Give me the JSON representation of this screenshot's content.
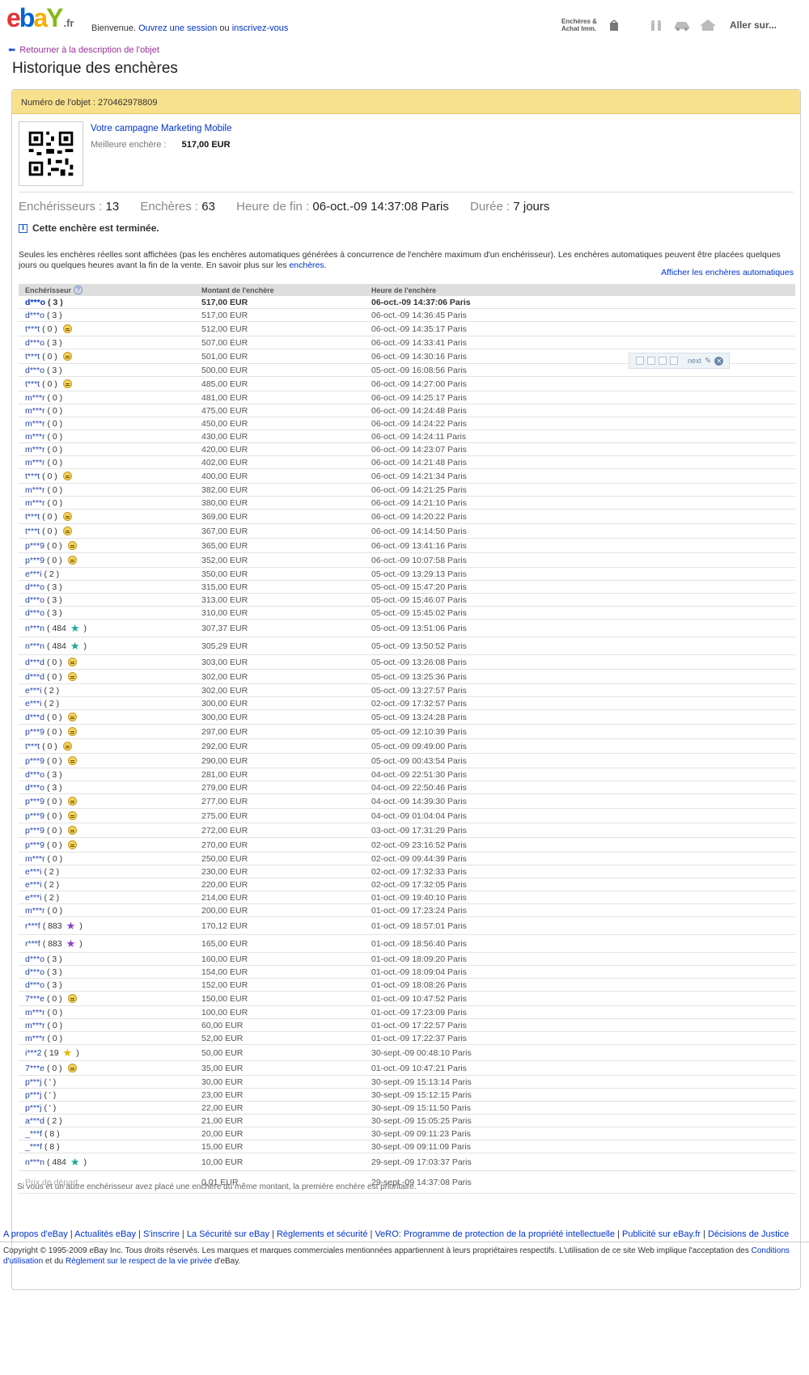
{
  "header": {
    "logo": "ebay",
    "logo_suffix": ".fr",
    "welcome": "Bienvenue.",
    "signin_link": "Ouvrez une session",
    "or": "ou",
    "register_link": "inscrivez-vous",
    "right_label_line1": "Enchères &",
    "right_label_line2": "Achat Imm.",
    "goto": "Aller sur..."
  },
  "back_link": "Retourner à la description de l'objet",
  "page_title": "Historique des enchères",
  "item": {
    "number_label": "Numéro de l'objet :",
    "number": "270462978809",
    "campaign_link": "Votre campagne Marketing Mobile",
    "best_bid_label": "Meilleure enchère :",
    "best_bid_value": "517,00 EUR"
  },
  "stats": {
    "bidders_label": "Enchérisseurs :",
    "bidders": "13",
    "bids_label": "Enchères :",
    "bids": "63",
    "end_label": "Heure de fin :",
    "end": "06-oct.-09 14:37:08 Paris",
    "duration_label": "Durée :",
    "duration": "7 jours"
  },
  "ended_msg": "Cette enchère est terminée.",
  "note": "Seules les enchères réelles sont affichées (pas les enchères automatiques générées à concurrence de l'enchère maximum d'un enchérisseur). Les enchères automatiques peuvent être placées quelques jours ou quelques heures avant la fin de la vente. En savoir plus sur les",
  "note_link": "enchères",
  "auto_link": "Afficher les enchères automatiques",
  "table": {
    "headers": [
      "Enchérisseur",
      "Montant de l'enchère",
      "Heure de l'enchère"
    ],
    "rows": [
      {
        "bidder": "d***o",
        "fb": "( 3 )",
        "icon": "",
        "amount": "517,00 EUR",
        "time": "06-oct.-09 14:37:06 Paris"
      },
      {
        "bidder": "d***o",
        "fb": "( 3 )",
        "icon": "",
        "amount": "517,00 EUR",
        "time": "06-oct.-09 14:36:45 Paris"
      },
      {
        "bidder": "t***t",
        "fb": "( 0 )",
        "icon": "bee",
        "amount": "512,00 EUR",
        "time": "06-oct.-09 14:35:17 Paris"
      },
      {
        "bidder": "d***o",
        "fb": "( 3 )",
        "icon": "",
        "amount": "507,00 EUR",
        "time": "06-oct.-09 14:33:41 Paris"
      },
      {
        "bidder": "t***t",
        "fb": "( 0 )",
        "icon": "bee",
        "amount": "501,00 EUR",
        "time": "06-oct.-09 14:30:16 Paris"
      },
      {
        "bidder": "d***o",
        "fb": "( 3 )",
        "icon": "",
        "amount": "500,00 EUR",
        "time": "05-oct.-09 16:08:56 Paris"
      },
      {
        "bidder": "t***t",
        "fb": "( 0 )",
        "icon": "bee",
        "amount": "485,00 EUR",
        "time": "06-oct.-09 14:27:00 Paris"
      },
      {
        "bidder": "m***r",
        "fb": "( 0 )",
        "icon": "",
        "amount": "481,00 EUR",
        "time": "06-oct.-09 14:25:17 Paris"
      },
      {
        "bidder": "m***r",
        "fb": "( 0 )",
        "icon": "",
        "amount": "475,00 EUR",
        "time": "06-oct.-09 14:24:48 Paris"
      },
      {
        "bidder": "m***r",
        "fb": "( 0 )",
        "icon": "",
        "amount": "450,00 EUR",
        "time": "06-oct.-09 14:24:22 Paris"
      },
      {
        "bidder": "m***r",
        "fb": "( 0 )",
        "icon": "",
        "amount": "430,00 EUR",
        "time": "06-oct.-09 14:24:11 Paris"
      },
      {
        "bidder": "m***r",
        "fb": "( 0 )",
        "icon": "",
        "amount": "420,00 EUR",
        "time": "06-oct.-09 14:23:07 Paris"
      },
      {
        "bidder": "m***r",
        "fb": "( 0 )",
        "icon": "",
        "amount": "402,00 EUR",
        "time": "06-oct.-09 14:21:48 Paris"
      },
      {
        "bidder": "t***t",
        "fb": "( 0 )",
        "icon": "bee",
        "amount": "400,00 EUR",
        "time": "06-oct.-09 14:21:34 Paris"
      },
      {
        "bidder": "m***r",
        "fb": "( 0 )",
        "icon": "",
        "amount": "382,00 EUR",
        "time": "06-oct.-09 14:21:25 Paris"
      },
      {
        "bidder": "m***r",
        "fb": "( 0 )",
        "icon": "",
        "amount": "380,00 EUR",
        "time": "06-oct.-09 14:21:10 Paris"
      },
      {
        "bidder": "t***t",
        "fb": "( 0 )",
        "icon": "bee",
        "amount": "369,00 EUR",
        "time": "06-oct.-09 14:20:22 Paris"
      },
      {
        "bidder": "t***t",
        "fb": "( 0 )",
        "icon": "bee",
        "amount": "367,00 EUR",
        "time": "06-oct.-09 14:14:50 Paris"
      },
      {
        "bidder": "p***9",
        "fb": "( 0 )",
        "icon": "bee",
        "amount": "365,00 EUR",
        "time": "06-oct.-09 13:41:16 Paris"
      },
      {
        "bidder": "p***9",
        "fb": "( 0 )",
        "icon": "bee",
        "amount": "352,00 EUR",
        "time": "06-oct.-09 10:07:58 Paris"
      },
      {
        "bidder": "e***i",
        "fb": "( 2 )",
        "icon": "",
        "amount": "350,00 EUR",
        "time": "05-oct.-09 13:29:13 Paris"
      },
      {
        "bidder": "d***o",
        "fb": "( 3 )",
        "icon": "",
        "amount": "315,00 EUR",
        "time": "05-oct.-09 15:47:20 Paris"
      },
      {
        "bidder": "d***o",
        "fb": "( 3 )",
        "icon": "",
        "amount": "313,00 EUR",
        "time": "05-oct.-09 15:46:07 Paris"
      },
      {
        "bidder": "d***o",
        "fb": "( 3 )",
        "icon": "",
        "amount": "310,00 EUR",
        "time": "05-oct.-09 15:45:02 Paris"
      },
      {
        "bidder": "n***n",
        "fb": "( 484",
        "icon": "star-turq",
        "fb_close": ")",
        "amount": "307,37 EUR",
        "time": "05-oct.-09 13:51:06 Paris"
      },
      {
        "bidder": "n***n",
        "fb": "( 484",
        "icon": "star-turq",
        "fb_close": ")",
        "amount": "305,29 EUR",
        "time": "05-oct.-09 13:50:52 Paris"
      },
      {
        "bidder": "d***d",
        "fb": "( 0 )",
        "icon": "bee",
        "amount": "303,00 EUR",
        "time": "05-oct.-09 13:26:08 Paris"
      },
      {
        "bidder": "d***d",
        "fb": "( 0 )",
        "icon": "bee",
        "amount": "302,00 EUR",
        "time": "05-oct.-09 13:25:36 Paris"
      },
      {
        "bidder": "e***i",
        "fb": "( 2 )",
        "icon": "",
        "amount": "302,00 EUR",
        "time": "05-oct.-09 13:27:57 Paris"
      },
      {
        "bidder": "e***i",
        "fb": "( 2 )",
        "icon": "",
        "amount": "300,00 EUR",
        "time": "02-oct.-09 17:32:57 Paris"
      },
      {
        "bidder": "d***d",
        "fb": "( 0 )",
        "icon": "bee",
        "amount": "300,00 EUR",
        "time": "05-oct.-09 13:24:28 Paris"
      },
      {
        "bidder": "p***9",
        "fb": "( 0 )",
        "icon": "bee",
        "amount": "297,00 EUR",
        "time": "05-oct.-09 12:10:39 Paris"
      },
      {
        "bidder": "t***t",
        "fb": "( 0 )",
        "icon": "bee",
        "amount": "292,00 EUR",
        "time": "05-oct.-09 09:49:00 Paris"
      },
      {
        "bidder": "p***9",
        "fb": "( 0 )",
        "icon": "bee",
        "amount": "290,00 EUR",
        "time": "05-oct.-09 00:43:54 Paris"
      },
      {
        "bidder": "d***o",
        "fb": "( 3 )",
        "icon": "",
        "amount": "281,00 EUR",
        "time": "04-oct.-09 22:51:30 Paris"
      },
      {
        "bidder": "d***o",
        "fb": "( 3 )",
        "icon": "",
        "amount": "279,00 EUR",
        "time": "04-oct.-09 22:50:46 Paris"
      },
      {
        "bidder": "p***9",
        "fb": "( 0 )",
        "icon": "bee",
        "amount": "277,00 EUR",
        "time": "04-oct.-09 14:39:30 Paris"
      },
      {
        "bidder": "p***9",
        "fb": "( 0 )",
        "icon": "bee",
        "amount": "275,00 EUR",
        "time": "04-oct.-09 01:04:04 Paris"
      },
      {
        "bidder": "p***9",
        "fb": "( 0 )",
        "icon": "bee",
        "amount": "272,00 EUR",
        "time": "03-oct.-09 17:31:29 Paris"
      },
      {
        "bidder": "p***9",
        "fb": "( 0 )",
        "icon": "bee",
        "amount": "270,00 EUR",
        "time": "02-oct.-09 23:16:52 Paris"
      },
      {
        "bidder": "m***r",
        "fb": "( 0 )",
        "icon": "",
        "amount": "250,00 EUR",
        "time": "02-oct.-09 09:44:39 Paris"
      },
      {
        "bidder": "e***i",
        "fb": "( 2 )",
        "icon": "",
        "amount": "230,00 EUR",
        "time": "02-oct.-09 17:32:33 Paris"
      },
      {
        "bidder": "e***i",
        "fb": "( 2 )",
        "icon": "",
        "amount": "220,00 EUR",
        "time": "02-oct.-09 17:32:05 Paris"
      },
      {
        "bidder": "e***i",
        "fb": "( 2 )",
        "icon": "",
        "amount": "214,00 EUR",
        "time": "01-oct.-09 19:40:10 Paris"
      },
      {
        "bidder": "m***r",
        "fb": "( 0 )",
        "icon": "",
        "amount": "200,00 EUR",
        "time": "01-oct.-09 17:23:24 Paris"
      },
      {
        "bidder": "r***f",
        "fb": "( 883",
        "icon": "star-purple",
        "fb_close": ")",
        "amount": "170,12 EUR",
        "time": "01-oct.-09 18:57:01 Paris"
      },
      {
        "bidder": "r***f",
        "fb": "( 883",
        "icon": "star-purple",
        "fb_close": ")",
        "amount": "165,00 EUR",
        "time": "01-oct.-09 18:56:40 Paris"
      },
      {
        "bidder": "d***o",
        "fb": "( 3 )",
        "icon": "",
        "amount": "160,00 EUR",
        "time": "01-oct.-09 18:09:20 Paris"
      },
      {
        "bidder": "d***o",
        "fb": "( 3 )",
        "icon": "",
        "amount": "154,00 EUR",
        "time": "01-oct.-09 18:09:04 Paris"
      },
      {
        "bidder": "d***o",
        "fb": "( 3 )",
        "icon": "",
        "amount": "152,00 EUR",
        "time": "01-oct.-09 18:08:26 Paris"
      },
      {
        "bidder": "7***e",
        "fb": "( 0 )",
        "icon": "bee",
        "amount": "150,00 EUR",
        "time": "01-oct.-09 10:47:52 Paris"
      },
      {
        "bidder": "m***r",
        "fb": "( 0 )",
        "icon": "",
        "amount": "100,00 EUR",
        "time": "01-oct.-09 17:23:09 Paris"
      },
      {
        "bidder": "m***r",
        "fb": "( 0 )",
        "icon": "",
        "amount": "60,00 EUR",
        "time": "01-oct.-09 17:22:57 Paris"
      },
      {
        "bidder": "m***r",
        "fb": "( 0 )",
        "icon": "",
        "amount": "52,00 EUR",
        "time": "01-oct.-09 17:22:37 Paris"
      },
      {
        "bidder": "i***2",
        "fb": "( 19",
        "icon": "star-yellow",
        "fb_close": ")",
        "amount": "50,00 EUR",
        "time": "30-sept.-09 00:48:10 Paris"
      },
      {
        "bidder": "7***e",
        "fb": "( 0 )",
        "icon": "bee",
        "amount": "35,00 EUR",
        "time": "01-oct.-09 10:47:21 Paris"
      },
      {
        "bidder": "p***j",
        "fb": "( ' )",
        "icon": "",
        "amount": "30,00 EUR",
        "time": "30-sept.-09 15:13:14 Paris"
      },
      {
        "bidder": "p***j",
        "fb": "( ' )",
        "icon": "",
        "amount": "23,00 EUR",
        "time": "30-sept.-09 15:12:15 Paris"
      },
      {
        "bidder": "p***j",
        "fb": "( ' )",
        "icon": "",
        "amount": "22,00 EUR",
        "time": "30-sept.-09 15:11:50 Paris"
      },
      {
        "bidder": "a***d",
        "fb": "( 2 )",
        "icon": "",
        "amount": "21,00 EUR",
        "time": "30-sept.-09 15:05:25 Paris"
      },
      {
        "bidder": "_***f",
        "fb": "( 8 )",
        "icon": "",
        "amount": "20,00 EUR",
        "time": "30-sept.-09 09:11:23 Paris"
      },
      {
        "bidder": "_***f",
        "fb": "( 8 )",
        "icon": "",
        "amount": "15,00 EUR",
        "time": "30-sept.-09 09:11:09 Paris"
      },
      {
        "bidder": "n***n",
        "fb": "( 484",
        "icon": "star-turq",
        "fb_close": ")",
        "amount": "10,00 EUR",
        "time": "29-sept.-09 17:03:37 Paris"
      }
    ],
    "start_row": {
      "label": "Prix de départ",
      "amount": "0,01 EUR",
      "time": "29-sept.-09 14:37:08 Paris"
    }
  },
  "floating_toolbar": {
    "next_label": "next"
  },
  "tie_note": "Si vous et un autre enchérisseur avez placé une enchère du même montant, la première enchère est prioritaire.",
  "footer": {
    "links": [
      "A propos d'eBay",
      "Actualités eBay",
      "S'inscrire",
      "La Sécurité sur eBay",
      "Règlements et sécurité",
      "VeRO: Programme de protection de la propriété intellectuelle",
      "Publicité sur eBay.fr",
      "Décisions de Justice"
    ],
    "copyright_1": "Copyright © 1995-2009 eBay Inc. Tous droits réservés. Les marques et marques commerciales mentionnées appartiennent à leurs propriétaires respectifs. L'utilisation de ce site Web implique l'acceptation des",
    "terms_link": "Conditions d'utilisation",
    "and": "et du",
    "privacy_link": "Règlement sur le respect de la vie privée",
    "copyright_2": "d'eBay."
  },
  "colors": {
    "link": "#0033cc",
    "item_bar": "#f8e18d",
    "header_row": "#dedede",
    "back_link": "#993399"
  }
}
